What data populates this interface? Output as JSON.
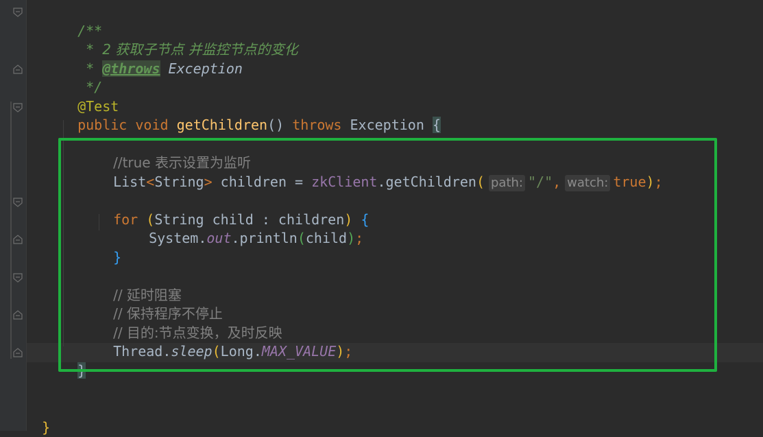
{
  "editor": {
    "lines": {
      "doc_open": "/**",
      "doc_line1_star": " * ",
      "doc_line1_text": "2 获取子节点 并监控节点的变化",
      "doc_line2_star": " * ",
      "doc_line2_tag": "@throws",
      "doc_line2_type": " Exception",
      "doc_close": " */",
      "annotation": "@Test",
      "sig_public": "public",
      "sig_void": "void",
      "sig_method": "getChildren",
      "sig_parens": "()",
      "sig_throws": "throws",
      "sig_exception": "Exception",
      "sig_brace": "{",
      "comment_true": "//true 表示设置为监听",
      "list_decl_type": "List",
      "list_decl_lt": "<",
      "list_decl_generic": "String",
      "list_decl_gt": ">",
      "list_decl_var": " children = ",
      "list_call_obj": "zkClient",
      "list_call_dot": ".",
      "list_call_method": "getChildren",
      "list_open": "(",
      "hint_path": "path:",
      "arg_path": "\"/\"",
      "arg_comma": ",",
      "hint_watch": "watch:",
      "arg_watch": "true",
      "list_close": ")",
      "semi": ";",
      "for_kw": "for",
      "for_open": "(",
      "for_body": "String child : children",
      "for_close": ")",
      "for_brace": "{",
      "println_obj": "System.",
      "println_field": "out",
      "println_call": ".println",
      "println_open": "(",
      "println_arg": "child",
      "println_close": ")",
      "for_end_brace": "}",
      "comment_block1": "// 延时阻塞",
      "comment_block2": "// 保持程序不停止",
      "comment_block3": "// 目的:节点变换，及时反映",
      "sleep_obj": "Thread.",
      "sleep_method": "sleep",
      "sleep_open": "(",
      "sleep_long": "Long.",
      "sleep_const": "MAX_VALUE",
      "sleep_close": ")",
      "method_end_brace": "}",
      "class_end_brace": "}"
    }
  },
  "colors": {
    "background": "#2b2b2b",
    "keyword": "#cc7832",
    "method": "#ffc66d",
    "string": "#6a8759",
    "doc_comment": "#629755",
    "highlight_frame": "#1fb13f"
  }
}
